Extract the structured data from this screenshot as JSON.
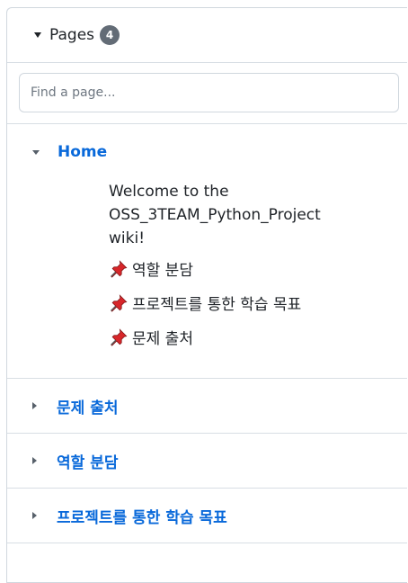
{
  "sidebar": {
    "title": "Pages",
    "count": "4",
    "search": {
      "placeholder": "Find a page...",
      "value": ""
    },
    "pages": [
      {
        "label": "Home",
        "expanded": true,
        "toc": [
          {
            "text": "Welcome to the OSS_3TEAM_Python_Project wiki!"
          },
          {
            "text": "역할 분담",
            "icon": "pushpin-icon"
          },
          {
            "text": "프로젝트를 통한 학습 목표",
            "icon": "pushpin-icon"
          },
          {
            "text": "문제 출처",
            "icon": "pushpin-icon"
          }
        ]
      },
      {
        "label": "문제 출처",
        "expanded": false
      },
      {
        "label": "역할 분담",
        "expanded": false
      },
      {
        "label": "프로젝트를 통한 학습 목표",
        "expanded": false
      }
    ]
  },
  "colors": {
    "link": "#0969da",
    "counter_bg": "#636c76",
    "border": "#d0d7de",
    "pin_red": "#d7262a"
  }
}
